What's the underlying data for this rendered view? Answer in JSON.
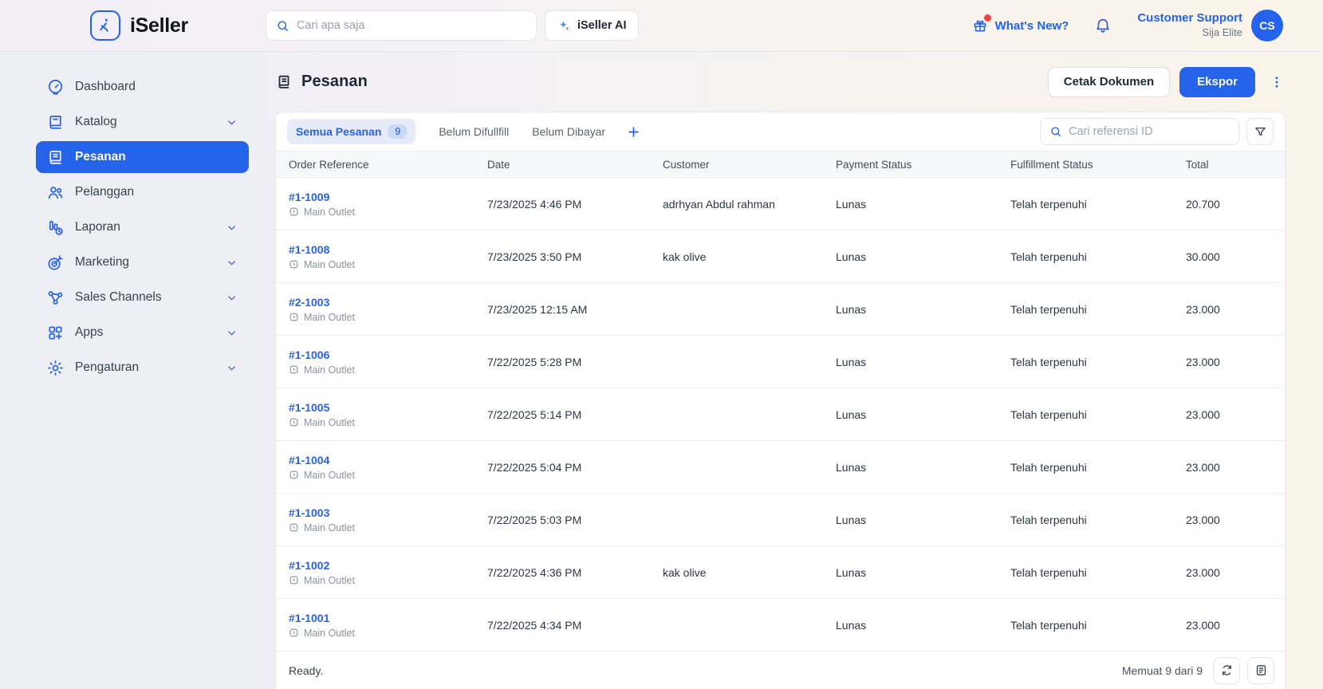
{
  "colors": {
    "accent": "#2563eb",
    "notification_dot": "#ef4444"
  },
  "header": {
    "brand": "iSeller",
    "search_placeholder": "Cari apa saja",
    "ai_button_label": "iSeller AI",
    "whats_new_label": "What's New?",
    "account_name": "Customer Support",
    "account_plan": "Sija Elite",
    "avatar_initials": "CS"
  },
  "sidebar": {
    "items": [
      {
        "label": "Dashboard",
        "icon": "dashboard",
        "expandable": false,
        "active": false
      },
      {
        "label": "Katalog",
        "icon": "katalog",
        "expandable": true,
        "active": false
      },
      {
        "label": "Pesanan",
        "icon": "pesanan",
        "expandable": false,
        "active": true
      },
      {
        "label": "Pelanggan",
        "icon": "pelanggan",
        "expandable": false,
        "active": false
      },
      {
        "label": "Laporan",
        "icon": "laporan",
        "expandable": true,
        "active": false
      },
      {
        "label": "Marketing",
        "icon": "marketing",
        "expandable": true,
        "active": false
      },
      {
        "label": "Sales Channels",
        "icon": "sales-channels",
        "expandable": true,
        "active": false
      },
      {
        "label": "Apps",
        "icon": "apps",
        "expandable": true,
        "active": false
      },
      {
        "label": "Pengaturan",
        "icon": "pengaturan",
        "expandable": true,
        "active": false
      }
    ]
  },
  "page": {
    "title": "Pesanan",
    "print_button_label": "Cetak Dokumen",
    "export_button_label": "Ekspor"
  },
  "tabs": {
    "active_label": "Semua Pesanan",
    "active_count": "9",
    "others": [
      "Belum Difullfill",
      "Belum Dibayar"
    ]
  },
  "list_search_placeholder": "Cari referensi ID",
  "table": {
    "columns": [
      "Order Reference",
      "Date",
      "Customer",
      "Payment Status",
      "Fulfillment Status",
      "Total"
    ],
    "rows": [
      {
        "ref": "#1-1009",
        "outlet": "Main Outlet",
        "date": "7/23/2025 4:46 PM",
        "customer": "adrhyan Abdul rahman",
        "payment": "Lunas",
        "fulfillment": "Telah terpenuhi",
        "total": "20.700"
      },
      {
        "ref": "#1-1008",
        "outlet": "Main Outlet",
        "date": "7/23/2025 3:50 PM",
        "customer": "kak olive",
        "payment": "Lunas",
        "fulfillment": "Telah terpenuhi",
        "total": "30.000"
      },
      {
        "ref": "#2-1003",
        "outlet": "Main Outlet",
        "date": "7/23/2025 12:15 AM",
        "customer": "",
        "payment": "Lunas",
        "fulfillment": "Telah terpenuhi",
        "total": "23.000"
      },
      {
        "ref": "#1-1006",
        "outlet": "Main Outlet",
        "date": "7/22/2025 5:28 PM",
        "customer": "",
        "payment": "Lunas",
        "fulfillment": "Telah terpenuhi",
        "total": "23.000"
      },
      {
        "ref": "#1-1005",
        "outlet": "Main Outlet",
        "date": "7/22/2025 5:14 PM",
        "customer": "",
        "payment": "Lunas",
        "fulfillment": "Telah terpenuhi",
        "total": "23.000"
      },
      {
        "ref": "#1-1004",
        "outlet": "Main Outlet",
        "date": "7/22/2025 5:04 PM",
        "customer": "",
        "payment": "Lunas",
        "fulfillment": "Telah terpenuhi",
        "total": "23.000"
      },
      {
        "ref": "#1-1003",
        "outlet": "Main Outlet",
        "date": "7/22/2025 5:03 PM",
        "customer": "",
        "payment": "Lunas",
        "fulfillment": "Telah terpenuhi",
        "total": "23.000"
      },
      {
        "ref": "#1-1002",
        "outlet": "Main Outlet",
        "date": "7/22/2025 4:36 PM",
        "customer": "kak olive",
        "payment": "Lunas",
        "fulfillment": "Telah terpenuhi",
        "total": "23.000"
      },
      {
        "ref": "#1-1001",
        "outlet": "Main Outlet",
        "date": "7/22/2025 4:34 PM",
        "customer": "",
        "payment": "Lunas",
        "fulfillment": "Telah terpenuhi",
        "total": "23.000"
      }
    ]
  },
  "footer": {
    "status_text": "Ready.",
    "count_text": "Memuat 9 dari 9"
  }
}
